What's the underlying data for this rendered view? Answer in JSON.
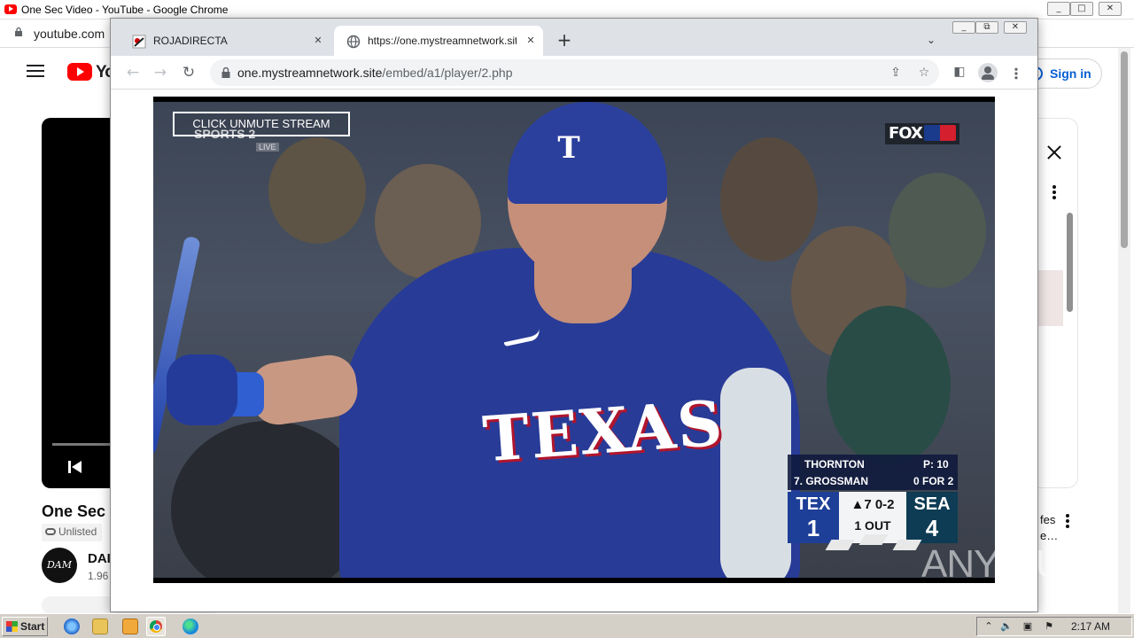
{
  "background_window": {
    "title": "One Sec Video - YouTube - Google Chrome",
    "url": "youtube.com",
    "youtube": {
      "logo_text": "You",
      "sign_in_label": "Sign in",
      "video_title": "One Sec",
      "unlisted_label": "Unlisted",
      "channel_avatar_text": "DAM",
      "channel_name": "DAI",
      "subscriber_count": "1.96",
      "recommended_title_line1": "fes",
      "recommended_title_line2": "e…"
    }
  },
  "foreground_window": {
    "tabs": [
      {
        "title": "ROJADIRECTA",
        "active": false
      },
      {
        "title": "https://one.mystreamnetwork.site/e",
        "active": true
      }
    ],
    "url_host": "one.mystreamnetwork.site",
    "url_path": "/embed/a1/player/2.php"
  },
  "stream": {
    "unmute_label": "CLICK UNMUTE STREAM",
    "channel_bug": "SPORTS 2",
    "channel_bug_live": "LIVE",
    "broadcaster": "FOX",
    "jersey_text": "TEXAS",
    "scorebug": {
      "pitcher": "THORNTON",
      "pitch_count": "P: 10",
      "batter": "7. GROSSMAN",
      "batter_line": "0 FOR 2",
      "away_team": "TEX",
      "away_runs": "1",
      "inning": "▲7 0-2",
      "outs": "1 OUT",
      "home_team": "SEA",
      "home_runs": "4"
    }
  },
  "watermark": "ANY RUN",
  "taskbar": {
    "start_label": "Start",
    "clock": "2:17 AM"
  },
  "colors": {
    "tex_blue": "#1e3f97",
    "sea_navy": "#0d3c54",
    "youtube_red": "#ff0000",
    "link_blue": "#065fd4"
  }
}
